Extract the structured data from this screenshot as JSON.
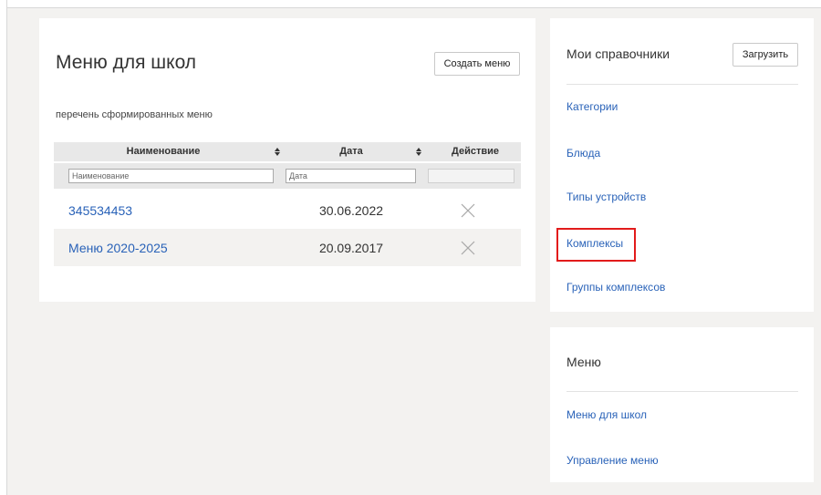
{
  "main": {
    "title": "Меню для школ",
    "create_button": "Создать меню",
    "subtitle": "перечень сформированных меню",
    "table": {
      "columns": [
        "Наименование",
        "Дата",
        "Действие"
      ],
      "filters": {
        "name_placeholder": "Наименование",
        "date_placeholder": "Дата"
      },
      "rows": [
        {
          "name": "345534453",
          "date": "30.06.2022"
        },
        {
          "name": "Меню 2020-2025",
          "date": "20.09.2017"
        }
      ]
    }
  },
  "sidebar": {
    "directories": {
      "title": "Мои справочники",
      "load_button": "Загрузить",
      "links": [
        "Категории",
        "Блюда",
        "Типы устройств",
        "Комплексы",
        "Группы комплексов"
      ],
      "highlighted_index": 3
    },
    "menu": {
      "title": "Меню",
      "links": [
        "Меню для школ",
        "Управление меню"
      ]
    }
  },
  "colors": {
    "link": "#2962b8",
    "highlight_border": "#e21b1b",
    "page_background": "#f3f2f0",
    "header_background": "#e8e8e8"
  },
  "icons": {
    "sort": "sort-icon",
    "delete": "close-icon"
  }
}
